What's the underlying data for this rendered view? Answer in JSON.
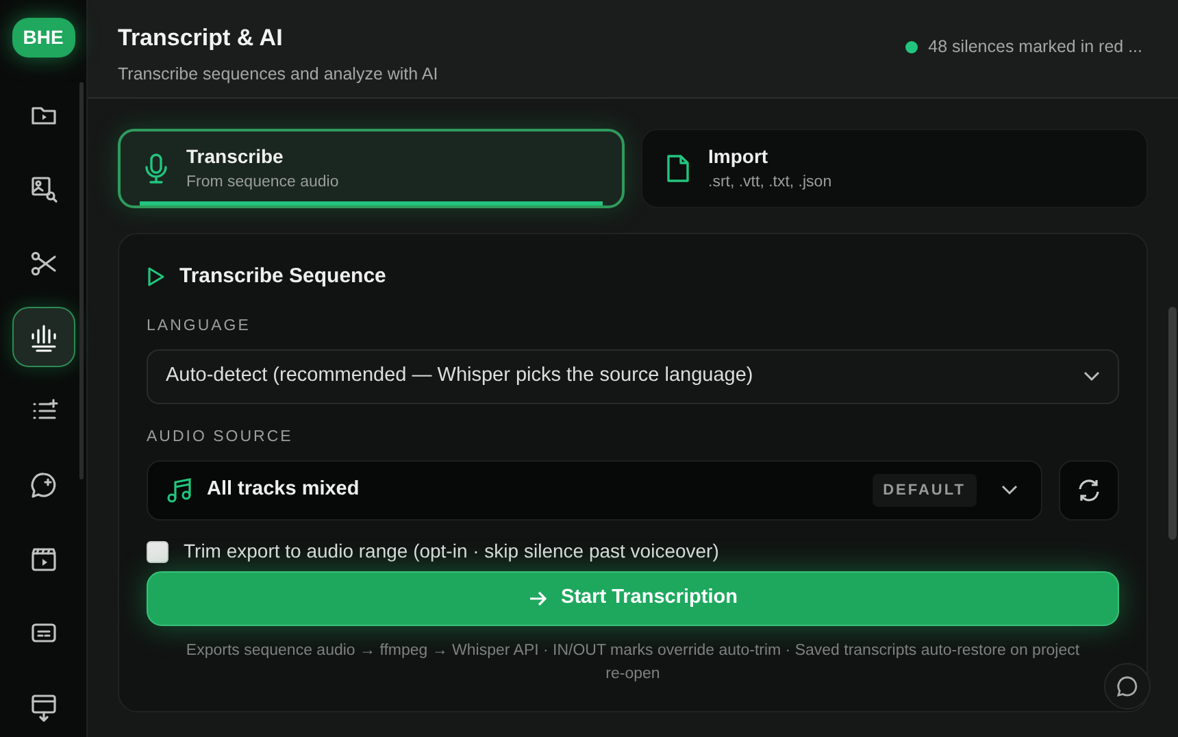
{
  "logo": "BHE",
  "nav": [
    {
      "kind": "folder",
      "selected": false
    },
    {
      "kind": "image-search",
      "selected": false
    },
    {
      "kind": "scissors",
      "selected": false
    },
    {
      "kind": "waveform",
      "selected": true
    },
    {
      "kind": "list",
      "selected": false
    },
    {
      "kind": "chat",
      "selected": false
    },
    {
      "kind": "clapper",
      "selected": false
    },
    {
      "kind": "subtitles",
      "selected": false
    },
    {
      "kind": "export",
      "selected": false
    }
  ],
  "header": {
    "title": "Transcript & AI",
    "subtitle": "Transcribe sequences and analyze with AI",
    "status": {
      "text": "48 silences marked in red ...",
      "color": "#22c57e"
    }
  },
  "tabs": [
    {
      "kind": "mic",
      "label": "Transcribe",
      "sub": "From sequence audio",
      "selected": true
    },
    {
      "kind": "file",
      "label": "Import",
      "sub": ".srt, .vtt, .txt, .json",
      "selected": false
    }
  ],
  "card": {
    "title": "Transcribe Sequence",
    "language": {
      "label": "LANGUAGE",
      "value": "Auto-detect (recommended — Whisper picks the source language)"
    },
    "audio_source": {
      "label": "AUDIO SOURCE",
      "value": "All tracks mixed",
      "badge": "DEFAULT"
    },
    "trim": {
      "label": "Trim export to audio range (opt-in · skip silence past voiceover)",
      "checked": false
    },
    "button": "Start Transcription",
    "note": "Exports sequence audio → ffmpeg → Whisper API · IN/OUT marks override auto-trim · Saved transcripts auto-restore on project re-open"
  }
}
